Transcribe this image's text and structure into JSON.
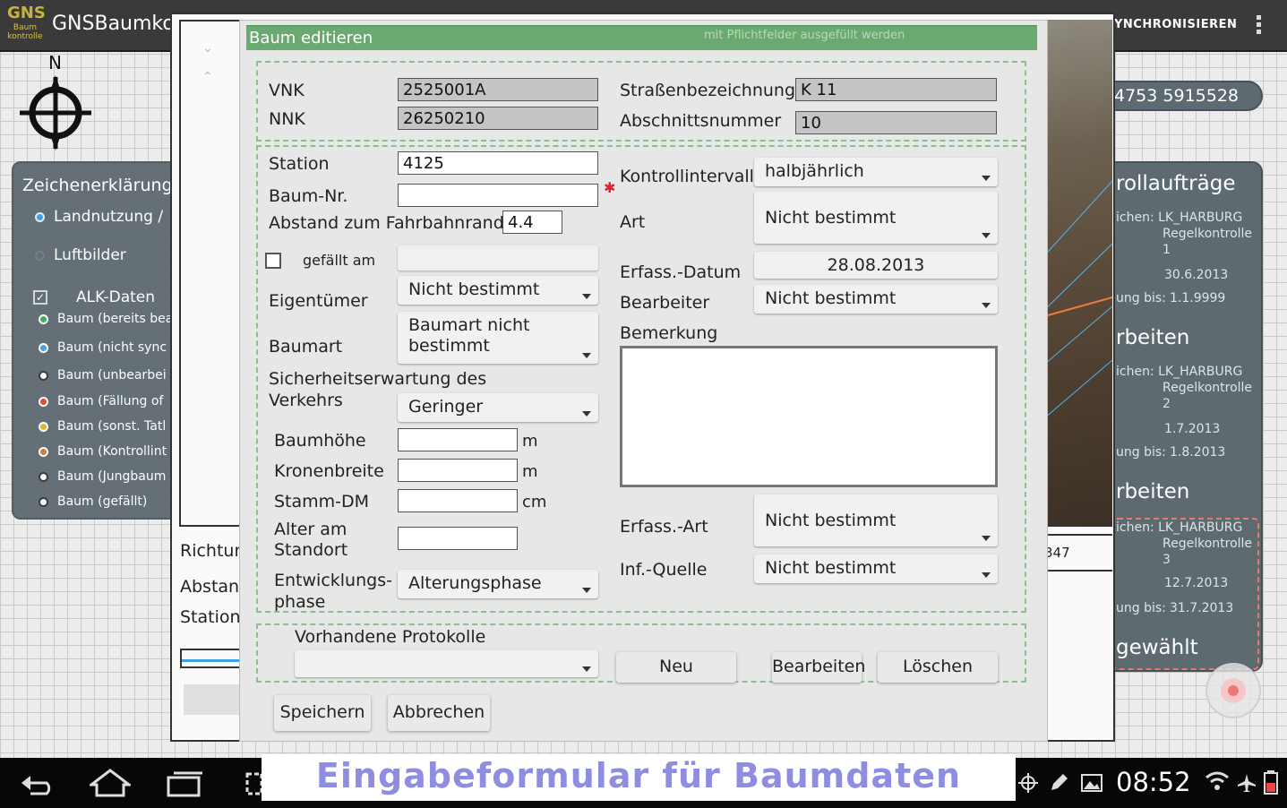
{
  "app": {
    "logo_text": "GNS",
    "logo_subtitle_1": "Baum",
    "logo_subtitle_2": "kontrolle",
    "title": "GNSBaumko",
    "sync_label": "YNCHRONISIEREN",
    "compass_label": "N"
  },
  "legend": {
    "title": "Zeichenerklärung",
    "layers": [
      {
        "label": "Landnutzung /",
        "color": "#3aa0e0"
      },
      {
        "label": "Luftbilder",
        "color": "#7b868b"
      }
    ],
    "alk_label": "ALK-Daten",
    "items": [
      {
        "label": "Baum (bereits bea",
        "color": "#2db04a"
      },
      {
        "label": "Baum (nicht sync",
        "color": "#3aa0e0"
      },
      {
        "label": "Baum (unbearbei",
        "color": "#ffffff"
      },
      {
        "label": "Baum (Fällung of",
        "color": "#e2452c"
      },
      {
        "label": "Baum (sonst. Tatl",
        "color": "#e8b020"
      },
      {
        "label": "Baum (Kontrollint",
        "color": "#c87a3a"
      },
      {
        "label": "Baum (Jungbaum",
        "color": "#ffffff"
      },
      {
        "label": "Baum (gefällt)",
        "color": "#ffffff"
      }
    ]
  },
  "coords": "4753  5915528",
  "orders": {
    "title": "rollaufträge",
    "cards": [
      {
        "line1": "ichen:  LK_HARBURG",
        "line2": "Regelkontrolle",
        "line3": "1",
        "from": "30.6.2013",
        "to_label": "ung bis:",
        "to": "1.1.9999",
        "action": "rbeiten"
      },
      {
        "line1": "ichen:  LK_HARBURG",
        "line2": "Regelkontrolle",
        "line3": "2",
        "from": "1.7.2013",
        "to_label": "ung bis:",
        "to": "1.8.2013",
        "action": "rbeiten"
      },
      {
        "line1": "ichen:  LK_HARBURG",
        "line2": "Regelkontrolle",
        "line3": "3",
        "from": "12.7.2013",
        "to_label": "ung bis:",
        "to": "31.7.2013",
        "action": "gewählt"
      }
    ]
  },
  "frame": {
    "labels": [
      "Richtun",
      "Abstand",
      "Station"
    ],
    "right_value": "347"
  },
  "dialog": {
    "title": "Baum editieren",
    "hint": "mit Pflichtfelder ausgefüllt werden",
    "vnk_label": "VNK",
    "vnk": "2525001A",
    "nnk_label": "NNK",
    "nnk": "26250210",
    "street_label": "Straßenbezeichnung",
    "street": "K 11",
    "section_label": "Abschnittsnummer",
    "section": "10",
    "station_label": "Station",
    "station": "4125",
    "tree_no_label": "Baum-Nr.",
    "tree_no": "",
    "distance_label": "Abstand zum Fahrbahnrand",
    "distance": "4.4",
    "felled_label": "gefällt am",
    "owner_label": "Eigentümer",
    "owner": "Nicht bestimmt",
    "species_label": "Baumart",
    "species": "Baumart nicht bestimmt",
    "safety_label_1": "Sicherheitserwartung des",
    "safety_label_2": "Verkehrs",
    "safety": "Geringer",
    "height_label": "Baumhöhe",
    "crown_label": "Kronenbreite",
    "trunk_label": "Stamm-DM",
    "age_label_1": "Alter am",
    "age_label_2": "Standort",
    "dev_label_1": "Entwicklungs-",
    "dev_label_2": "phase",
    "dev": "Alterungsphase",
    "unit_m": "m",
    "unit_cm": "cm",
    "interval_label": "Kontrollintervall",
    "interval": "halbjährlich",
    "type_label": "Art",
    "type": "Nicht bestimmt",
    "date_label": "Erfass.-Datum",
    "date": "28.08.2013",
    "editor_label": "Bearbeiter",
    "editor": "Nicht bestimmt",
    "remark_label": "Bemerkung",
    "capture_label": "Erfass.-Art",
    "capture": "Nicht bestimmt",
    "source_label": "Inf.-Quelle",
    "source": "Nicht bestimmt",
    "protocols_label": "Vorhandene Protokolle",
    "new_btn": "Neu",
    "edit_btn": "Bearbeiten",
    "delete_btn": "Löschen",
    "save_btn": "Speichern",
    "cancel_btn": "Abbrechen"
  },
  "caption": "Eingabeformular für Baumdaten",
  "statusbar": {
    "time": "08:52"
  }
}
